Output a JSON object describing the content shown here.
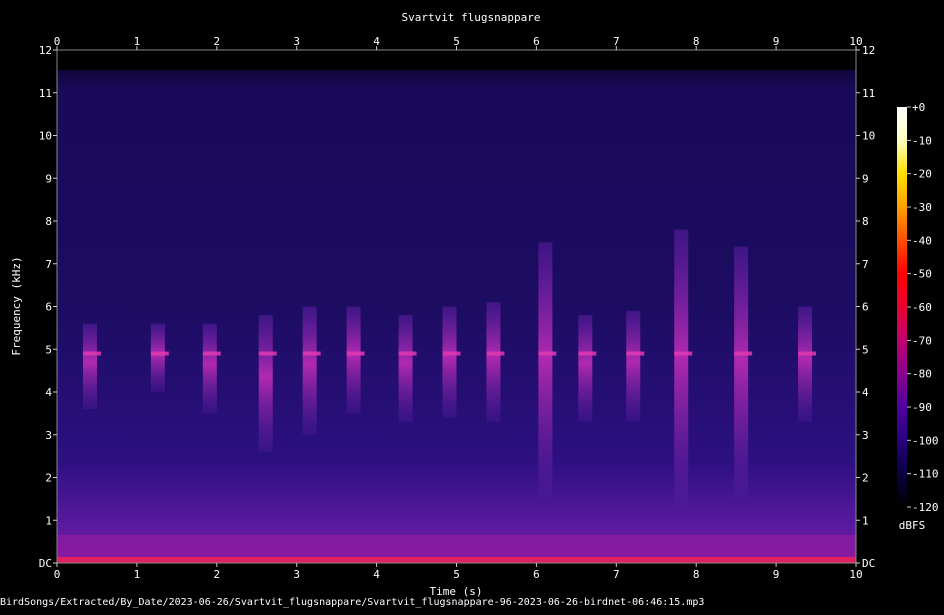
{
  "chart_data": {
    "type": "heatmap",
    "title": "Svartvit flugsnappare",
    "xlabel": "Time (s)",
    "ylabel": "Frequency (kHz)",
    "xlim": [
      0,
      10
    ],
    "ylim": [
      0,
      12
    ],
    "x_ticks": [
      "0",
      "1",
      "2",
      "3",
      "4",
      "5",
      "6",
      "7",
      "8",
      "9",
      "10"
    ],
    "y_ticks": [
      "DC",
      "1",
      "2",
      "3",
      "4",
      "5",
      "6",
      "7",
      "8",
      "9",
      "10",
      "11",
      "12"
    ],
    "colorbar": {
      "label": "dBFS",
      "range": [
        -120,
        0
      ],
      "ticks": [
        "+0",
        "-10",
        "-20",
        "-30",
        "-40",
        "-50",
        "-60",
        "-70",
        "-80",
        "-90",
        "-100",
        "-110",
        "-120"
      ],
      "colors": [
        "#ffffff",
        "#ffffc0",
        "#ffe000",
        "#ffa000",
        "#ff5000",
        "#ff0000",
        "#ea0030",
        "#c00070",
        "#8a0090",
        "#5000a0",
        "#280080",
        "#0a0040",
        "#000000"
      ]
    },
    "calls": [
      {
        "t": 0.4,
        "f_low": 3.6,
        "f_high": 5.6
      },
      {
        "t": 1.25,
        "f_low": 4.0,
        "f_high": 5.6
      },
      {
        "t": 1.9,
        "f_low": 3.5,
        "f_high": 5.6
      },
      {
        "t": 2.6,
        "f_low": 2.6,
        "f_high": 5.8
      },
      {
        "t": 3.15,
        "f_low": 3.0,
        "f_high": 6.0
      },
      {
        "t": 3.7,
        "f_low": 3.5,
        "f_high": 6.0
      },
      {
        "t": 4.35,
        "f_low": 3.3,
        "f_high": 5.8
      },
      {
        "t": 4.9,
        "f_low": 3.4,
        "f_high": 6.0
      },
      {
        "t": 5.45,
        "f_low": 3.3,
        "f_high": 6.1
      },
      {
        "t": 6.1,
        "f_low": 1.5,
        "f_high": 7.5
      },
      {
        "t": 6.6,
        "f_low": 3.3,
        "f_high": 5.8
      },
      {
        "t": 7.2,
        "f_low": 3.3,
        "f_high": 5.9
      },
      {
        "t": 7.8,
        "f_low": 1.2,
        "f_high": 7.8
      },
      {
        "t": 8.55,
        "f_low": 1.5,
        "f_high": 7.4
      },
      {
        "t": 9.35,
        "f_low": 3.3,
        "f_high": 6.0
      }
    ]
  },
  "footer": {
    "filename": "BirdSongs/Extracted/By_Date/2023-06-26/Svartvit_flugsnappare/Svartvit_flugsnappare-96-2023-06-26-birdnet-06:46:15.mp3"
  }
}
